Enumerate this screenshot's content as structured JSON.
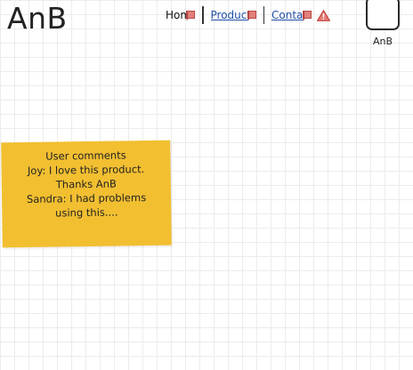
{
  "header": {
    "logo": "AnB",
    "nav": {
      "home_label": "Home",
      "products_label": "Products",
      "contact_label": "Contact"
    },
    "avatar_label": "AnB"
  },
  "sticky_note": {
    "lines": [
      "User comments",
      "Joy: I love this product.",
      "Thanks AnB",
      "Sandra: I had problems",
      "using this...."
    ]
  },
  "colors": {
    "sticky_background": "#f2bf31",
    "link": "#1f4fa8",
    "flag_icon": "#d9534f",
    "warning_icon": "#d9534f"
  },
  "icons": {
    "nav_flag": "flag-icon",
    "warning": "warning-icon"
  }
}
